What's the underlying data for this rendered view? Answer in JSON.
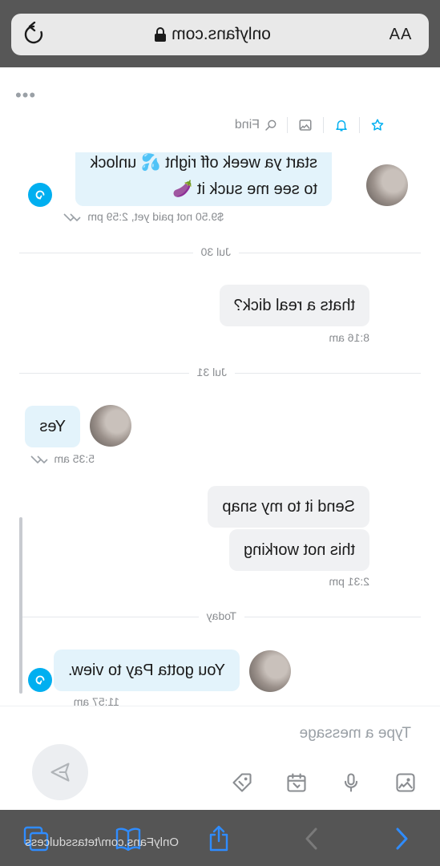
{
  "browser": {
    "url": "onlyfans.com",
    "text_size_label": "AA",
    "status_url": "OnlyFans.com/tetassdulcess"
  },
  "chat_header": {
    "more_label": "•••",
    "find_label": "Find"
  },
  "messages": {
    "m1_line1": "start ya week off right 💦 unlock",
    "m1_line2": "to see me suck it 🍆",
    "m1_meta": "$9.50 not paid yet, 2:59 pm",
    "date1": "Jul 30",
    "m2": "thats a real dick?",
    "m2_time": "8:16 am",
    "date2": "Jul 31",
    "m3": "Yes",
    "m3_time": "5:35 am",
    "m4": "Send it to my snap",
    "m5": "this not working",
    "m5_time": "2:31 pm",
    "date3": "Today",
    "m6": "You gotta Pay to view.",
    "m6_time": "11:57 am"
  },
  "composer": {
    "placeholder": "Type a message"
  },
  "colors": {
    "accent": "#00aff0",
    "incoming_bubble": "#e3f3fb",
    "outgoing_bubble": "#f0f1f3",
    "browser_bar": "#575757"
  },
  "icons": [
    "reload-icon",
    "lock-icon",
    "star-icon",
    "bell-icon",
    "image-icon",
    "search-icon",
    "tip-icon",
    "image-icon",
    "mic-icon",
    "calendar-icon",
    "tag-icon",
    "send-icon",
    "tabs-icon",
    "bookmarks-icon",
    "share-icon",
    "back-icon",
    "forward-icon"
  ]
}
